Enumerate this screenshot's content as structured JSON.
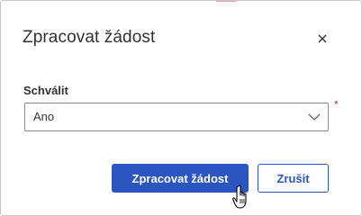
{
  "dialog": {
    "title": "Zpracovat žádost",
    "close_icon": "close-icon"
  },
  "field": {
    "label": "Schválit",
    "value": "Ano",
    "required_marker": "*",
    "dropdown_icon": "chevron-down-icon"
  },
  "buttons": {
    "primary_label": "Zpracovat žádost",
    "secondary_label": "Zrušit"
  },
  "colors": {
    "primary": "#2b55c0",
    "required": "#c4314b",
    "text": "#323130"
  },
  "cursor": "hand-pointer-icon"
}
